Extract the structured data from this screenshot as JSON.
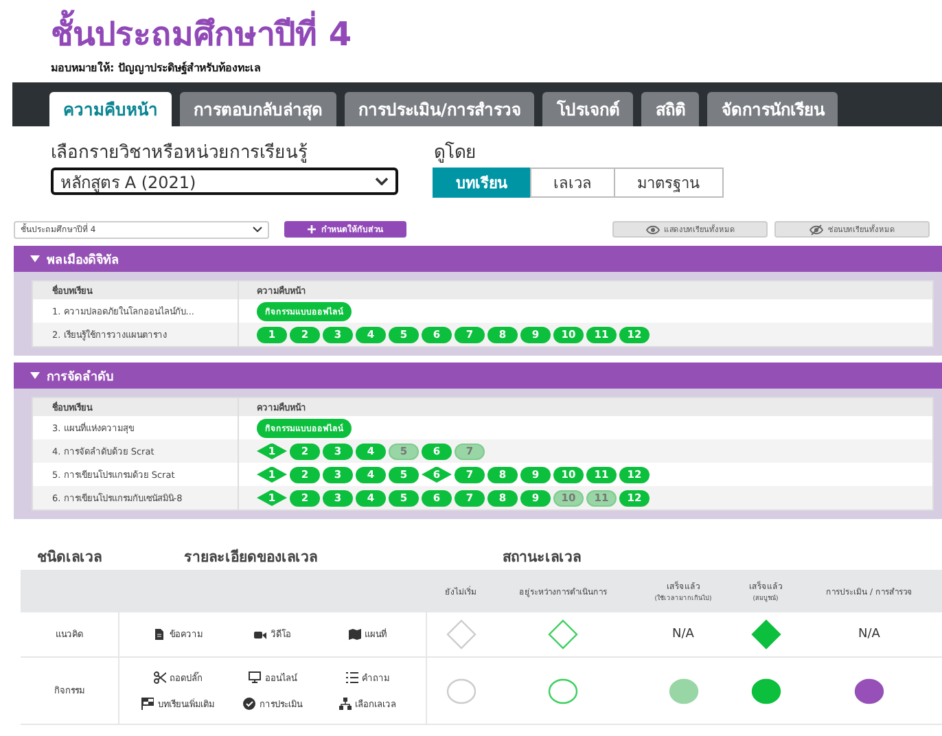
{
  "title": "ชั้นประถมศึกษาปีที่ 4",
  "assigned_to": "มอบหมายให้: ปัญญาประดิษฐ์สำหรับท้องทะเล",
  "tabs": [
    {
      "label": "ความคืบหน้า",
      "selected": true
    },
    {
      "label": "การตอบกลับล่าสุด",
      "selected": false
    },
    {
      "label": "การประเมิน/การสำรวจ",
      "selected": false
    },
    {
      "label": "โปรเจกต์",
      "selected": false
    },
    {
      "label": "สถิติ",
      "selected": false
    },
    {
      "label": "จัดการนักเรียน",
      "selected": false
    }
  ],
  "course_picker": {
    "label": "เลือกรายวิชาหรือหน่วยการเรียนรู้",
    "value": "หลักสูตร A (2021)"
  },
  "view_by": {
    "label": "ดูโดย",
    "options": [
      {
        "label": "บทเรียน",
        "selected": true
      },
      {
        "label": "เลเวล",
        "selected": false
      },
      {
        "label": "มาตรฐาน",
        "selected": false
      }
    ]
  },
  "toolbar": {
    "section_select": "ชั้นประถมศึกษาปีที่ 4",
    "assign_button": "กำหนดให้กับส่วน",
    "show_button": "แสดงบทเรียนทั้งหมด",
    "hide_button": "ซ่อนบทเรียนทั้งหมด"
  },
  "sections": [
    {
      "title": "พลเมืองดิจิทัล",
      "expanded": true,
      "columns": [
        "ชื่อบทเรียน",
        "ความคืบหน้า"
      ],
      "rows": [
        {
          "name": "1. ความปลอดภัยในโลกออนไลน์กับ...",
          "badge": "กิจกรรมแบบออฟไลน์"
        },
        {
          "name": "2. เรียนรู้ใช้การวางแผนตาราง",
          "levels": [
            {
              "label": "1",
              "kind": "circle",
              "complete": true
            },
            {
              "label": "2",
              "kind": "circle",
              "complete": true
            },
            {
              "label": "3",
              "kind": "circle",
              "complete": true
            },
            {
              "label": "4",
              "kind": "circle",
              "complete": true
            },
            {
              "label": "5",
              "kind": "circle",
              "complete": true
            },
            {
              "label": "6",
              "kind": "circle",
              "complete": true
            },
            {
              "label": "7",
              "kind": "circle",
              "complete": true
            },
            {
              "label": "8",
              "kind": "circle",
              "complete": true
            },
            {
              "label": "9",
              "kind": "circle",
              "complete": true
            },
            {
              "label": "10",
              "kind": "circle",
              "complete": true
            },
            {
              "label": "11",
              "kind": "circle",
              "complete": true
            },
            {
              "label": "12",
              "kind": "circle",
              "complete": true
            }
          ]
        }
      ]
    },
    {
      "title": "การจัดลำดับ",
      "expanded": true,
      "columns": [
        "ชื่อบทเรียน",
        "ความคืบหน้า"
      ],
      "rows": [
        {
          "name": "3. แผนที่แห่งความสุข",
          "badge": "กิจกรรมแบบออฟไลน์"
        },
        {
          "name": "4. การจัดลำดับด้วย Scrat",
          "levels": [
            {
              "label": "1",
              "kind": "diamond",
              "complete": true
            },
            {
              "label": "2",
              "kind": "circle",
              "complete": true
            },
            {
              "label": "3",
              "kind": "circle",
              "complete": true
            },
            {
              "label": "4",
              "kind": "circle",
              "complete": true
            },
            {
              "label": "5",
              "kind": "circle",
              "complete": false
            },
            {
              "label": "6",
              "kind": "circle",
              "complete": true
            },
            {
              "label": "7",
              "kind": "circle",
              "complete": false
            }
          ]
        },
        {
          "name": "5. การเขียนโปรแกรมด้วย Scrat",
          "levels": [
            {
              "label": "1",
              "kind": "diamond",
              "complete": true
            },
            {
              "label": "2",
              "kind": "circle",
              "complete": true
            },
            {
              "label": "3",
              "kind": "circle",
              "complete": true
            },
            {
              "label": "4",
              "kind": "circle",
              "complete": true
            },
            {
              "label": "5",
              "kind": "circle",
              "complete": true
            },
            {
              "label": "6",
              "kind": "diamond",
              "complete": true
            },
            {
              "label": "7",
              "kind": "circle",
              "complete": true
            },
            {
              "label": "8",
              "kind": "circle",
              "complete": true
            },
            {
              "label": "9",
              "kind": "circle",
              "complete": true
            },
            {
              "label": "10",
              "kind": "circle",
              "complete": true
            },
            {
              "label": "11",
              "kind": "circle",
              "complete": true
            },
            {
              "label": "12",
              "kind": "circle",
              "complete": true
            }
          ]
        },
        {
          "name": "6. การเขียนโปรแกรมกับเซนัสมินิ-8",
          "levels": [
            {
              "label": "1",
              "kind": "diamond",
              "complete": true
            },
            {
              "label": "2",
              "kind": "circle",
              "complete": true
            },
            {
              "label": "3",
              "kind": "circle",
              "complete": true
            },
            {
              "label": "4",
              "kind": "circle",
              "complete": true
            },
            {
              "label": "5",
              "kind": "circle",
              "complete": true
            },
            {
              "label": "6",
              "kind": "circle",
              "complete": true
            },
            {
              "label": "7",
              "kind": "circle",
              "complete": true
            },
            {
              "label": "8",
              "kind": "circle",
              "complete": true
            },
            {
              "label": "9",
              "kind": "circle",
              "complete": true
            },
            {
              "label": "10",
              "kind": "circle",
              "complete": false
            },
            {
              "label": "11",
              "kind": "circle",
              "complete": false
            },
            {
              "label": "12",
              "kind": "circle",
              "complete": true
            }
          ]
        }
      ]
    }
  ],
  "legend": {
    "headings": [
      "ชนิดเลเวล",
      "รายละเอียดของเลเวล",
      "สถานะเลเวล"
    ],
    "status_columns": [
      {
        "label": "ยังไม่เริ่ม"
      },
      {
        "label": "อยู่ระหว่างการดำเนินการ"
      },
      {
        "label": "เสร็จแล้ว",
        "note": "(ใช้เวลามากเกินไป)"
      },
      {
        "label": "เสร็จแล้ว",
        "note": "(สมบูรณ์)"
      },
      {
        "label": "การประเมิน / การสำรวจ"
      }
    ],
    "rows": [
      {
        "type": "แนวคิด",
        "details": [
          {
            "kind": "text",
            "label": "ข้อความ"
          },
          {
            "kind": "video",
            "label": "วิดีโอ"
          },
          {
            "kind": "map",
            "label": "แผนที่"
          }
        ],
        "cells": [
          {
            "kind": "diamond",
            "color": "#cccccc",
            "filled": false
          },
          {
            "kind": "diamond",
            "color": "#3ccf5e",
            "filled": false
          },
          {
            "kind": "text",
            "label": "N/A"
          },
          {
            "kind": "diamond",
            "color": "#0cbf3d",
            "filled": true
          },
          {
            "kind": "text",
            "label": "N/A"
          }
        ]
      },
      {
        "type": "กิจกรรม",
        "details": [
          {
            "kind": "unplugged",
            "label": "ถอดปลั๊ก"
          },
          {
            "kind": "online",
            "label": "ออนไลน์"
          },
          {
            "kind": "question",
            "label": "คำถาม"
          },
          {
            "kind": "extra",
            "label": "บทเรียนเพิ่มเติม"
          },
          {
            "kind": "assessment",
            "label": "การประเมิน"
          },
          {
            "kind": "choice",
            "label": "เลือกเลเวล"
          }
        ],
        "cells": [
          {
            "kind": "circle",
            "color": "#cccccc",
            "filled": false
          },
          {
            "kind": "circle",
            "color": "#3ccf5e",
            "filled": false
          },
          {
            "kind": "circle",
            "color": "#99d6a6",
            "filled": true
          },
          {
            "kind": "circle",
            "color": "#0cbf3d",
            "filled": true
          },
          {
            "kind": "circle",
            "color": "#9650b8",
            "filled": true
          }
        ]
      }
    ]
  }
}
